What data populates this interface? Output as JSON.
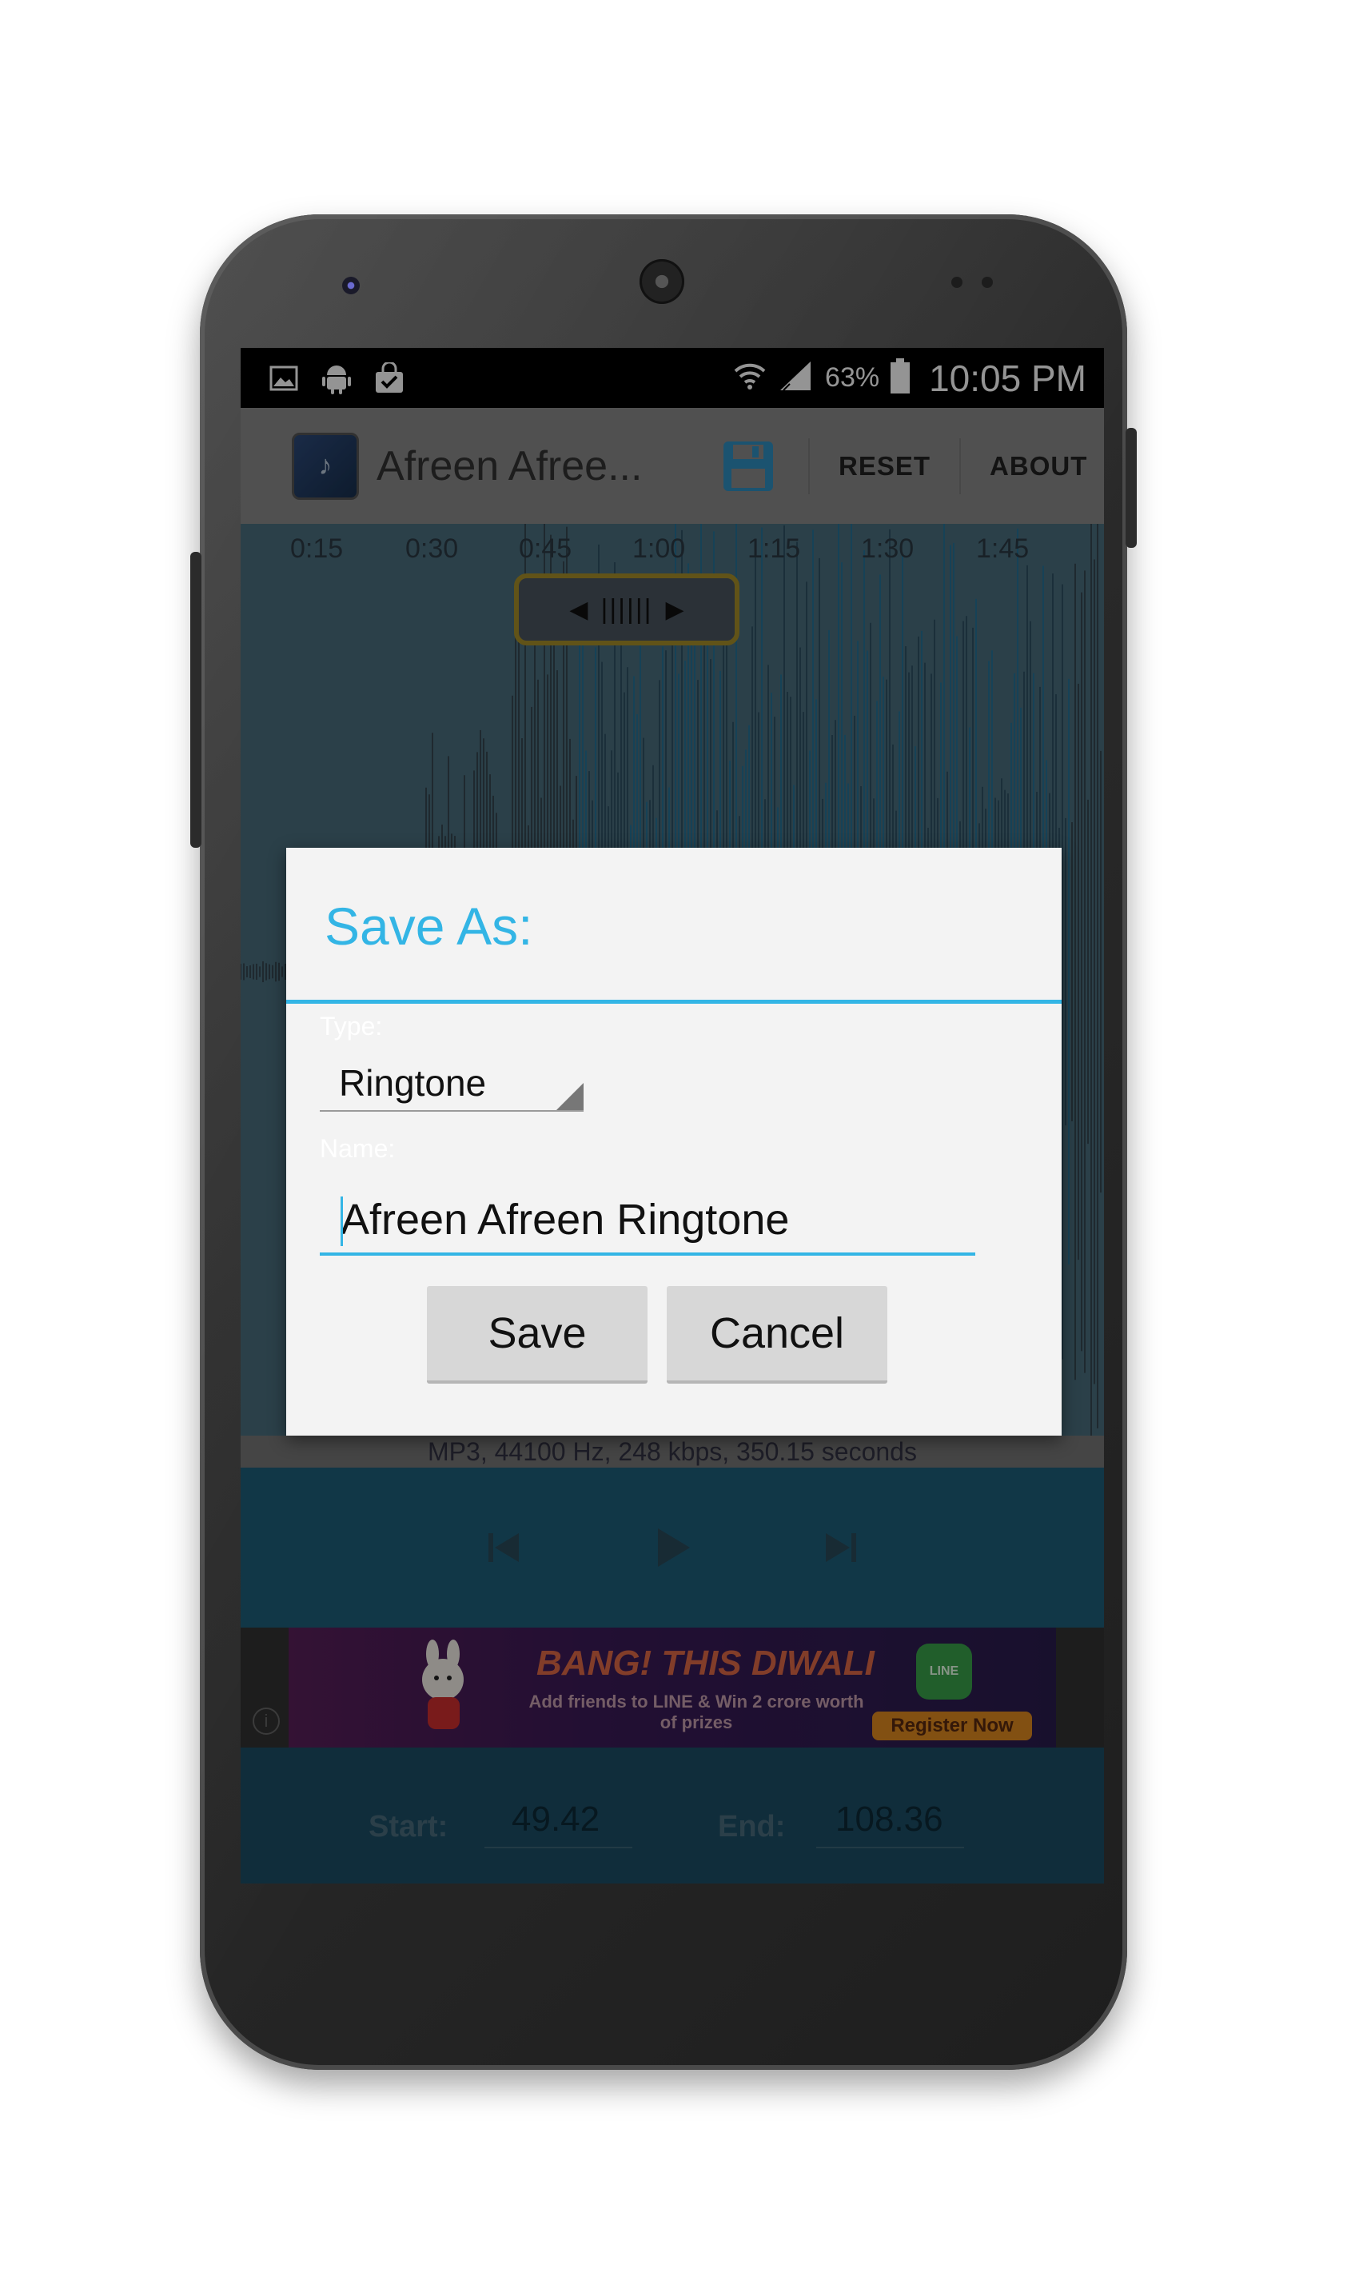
{
  "status_bar": {
    "battery_percent": "63%",
    "time": "10:05 PM",
    "icons": [
      "image-icon",
      "android-icon",
      "shopping-bag-icon",
      "wifi-icon",
      "signal-icon",
      "battery-icon"
    ]
  },
  "action_bar": {
    "title": "Afreen Afree...",
    "reset_label": "RESET",
    "about_label": "ABOUT"
  },
  "timeline": {
    "ticks": [
      "0:15",
      "0:30",
      "0:45",
      "1:00",
      "1:15",
      "1:30",
      "1:45"
    ]
  },
  "info_bar": {
    "text": "MP3, 44100 Hz, 248 kbps, 350.15 seconds"
  },
  "ad": {
    "headline": "BANG! THIS DIWALI",
    "subtext": "Add friends to LINE & Win 2 crore worth of prizes",
    "cta": "Register Now",
    "line_logo": "LINE"
  },
  "bottom": {
    "start_label": "Start:",
    "start_value": "49.42",
    "end_label": "End:",
    "end_value": "108.36"
  },
  "dialog": {
    "title": "Save As:",
    "type_label": "Type:",
    "type_value": "Ringtone",
    "name_label": "Name:",
    "name_value": "Afreen Afreen Ringtone",
    "save_label": "Save",
    "cancel_label": "Cancel"
  },
  "colors": {
    "accent": "#33b5e5",
    "wave_bg": "#476a7a",
    "controls_bg": "#1e5f7a"
  }
}
